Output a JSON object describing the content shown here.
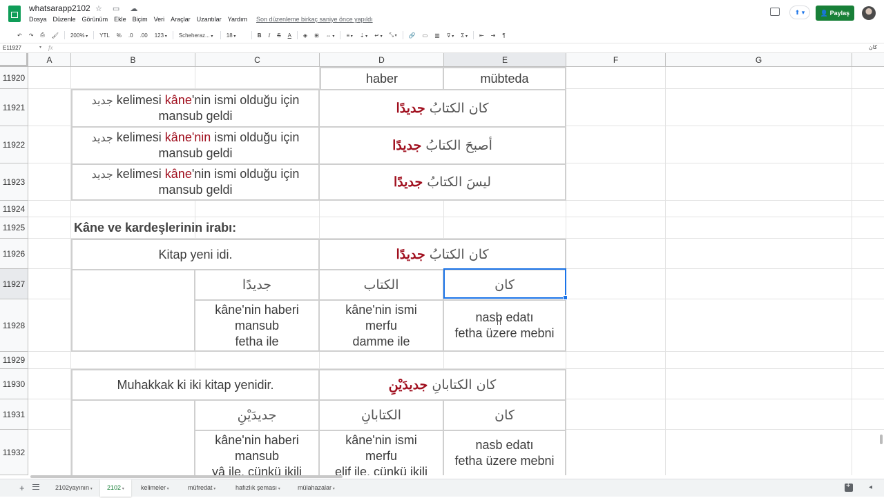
{
  "app": {
    "doc_title": "whatsarapp2102",
    "menu": [
      "Dosya",
      "Düzenle",
      "Görünüm",
      "Ekle",
      "Biçim",
      "Veri",
      "Araçlar",
      "Uzantılar",
      "Yardım"
    ],
    "last_edit": "Son düzenleme birkaç saniye önce yapıldı",
    "share_label": "Paylaş",
    "brand_color": "#0f9d58",
    "share_color": "#188038",
    "selection_color": "#1a73e8"
  },
  "toolbar": {
    "zoom": "200%",
    "currency": "YTL",
    "percent": "%",
    "dec_less": ".0",
    "dec_more": ".00",
    "more_formats": "123",
    "font": "Scheheraz...",
    "font_size": "18",
    "bold": "B",
    "italic": "I",
    "strike": "S",
    "text_color": "A",
    "icons": [
      "undo-icon",
      "redo-icon",
      "print-icon",
      "paint-format-icon",
      "fill-color-icon",
      "borders-icon",
      "merge-icon",
      "align-icon",
      "valign-icon",
      "wrap-icon",
      "rotate-icon",
      "link-icon",
      "comment-icon",
      "chart-icon",
      "filter-icon",
      "functions-icon",
      "rtl-icon",
      "ltr-icon",
      "pilcrow-icon"
    ]
  },
  "formula_bar": {
    "cell_ref": "E11927",
    "fx": "fx",
    "value": "كان"
  },
  "columns": [
    "A",
    "B",
    "C",
    "D",
    "E",
    "F",
    "G"
  ],
  "selected_column": "E",
  "rows": [
    "11920",
    "11921",
    "11922",
    "11923",
    "11924",
    "11925",
    "11926",
    "11927",
    "11928",
    "11929",
    "11930",
    "11931",
    "11932"
  ],
  "selected_row": "11927",
  "cells": {
    "r11920": {
      "d": "haber",
      "e": "mübteda"
    },
    "r11921": {
      "c_ar": "جديد",
      "c_word1": " kelimesi ",
      "c_kane": "kâne",
      "c_rest": "'nin ismi olduğu için",
      "c_line2": "mansub geldi",
      "de_pre": "كان الكتابُ ",
      "de_red": "جديدًا"
    },
    "r11922": {
      "c_ar": "جديد",
      "c_word1": " kelimesi ",
      "c_kane": "kâne'nin",
      "c_rest": " ismi olduğu için",
      "c_line2": "mansub geldi",
      "de_pre": "أصبحَ الكتابُ ",
      "de_red": "جديدًا"
    },
    "r11923": {
      "c_ar": "جديد",
      "c_word1": " kelimesi ",
      "c_kane": "kâne",
      "c_rest": "'nin ismi olduğu için",
      "c_line2": "mansub geldi",
      "de_pre": "ليسَ الكتابُ ",
      "de_red": "جديدًا"
    },
    "r11925": {
      "heading": "Kâne ve kardeşlerinin irabı:"
    },
    "r11926": {
      "bc": "Kitap yeni idi.",
      "de_pre": "كان الكتابُ ",
      "de_red": "جديدًا"
    },
    "r11927": {
      "c": "جديدًا",
      "d": "الكتاب",
      "e": "كان"
    },
    "r11928": {
      "c": [
        "kâne'nin haberi",
        "mansub",
        "fetha ile"
      ],
      "d": [
        "kâne'nin ismi",
        "merfu",
        "damme ile"
      ],
      "e": [
        "nasb edatı",
        "fetha üzere mebni"
      ]
    },
    "r11930": {
      "bc": "Muhakkak ki iki kitap yenidir.",
      "de_pre": "كان الكتابانِ ",
      "de_red": "جديدَيْنِ"
    },
    "r11931": {
      "c": "جديدَيْنِ",
      "d": "الكتابانِ",
      "e": "كان"
    },
    "r11932": {
      "c": [
        "kâne'nin haberi",
        "mansub",
        "yâ ile, çünkü ikili"
      ],
      "d": [
        "kâne'nin ismi",
        "merfu",
        "elif ile, çünkü ikili"
      ],
      "e": [
        "nasb edatı",
        "fetha üzere mebni"
      ]
    }
  },
  "sheet_tabs": [
    "2102yayının",
    "2102",
    "kelimeler",
    "müfredat",
    "hafızlık şeması",
    "mülahazalar"
  ],
  "active_tab": "2102"
}
